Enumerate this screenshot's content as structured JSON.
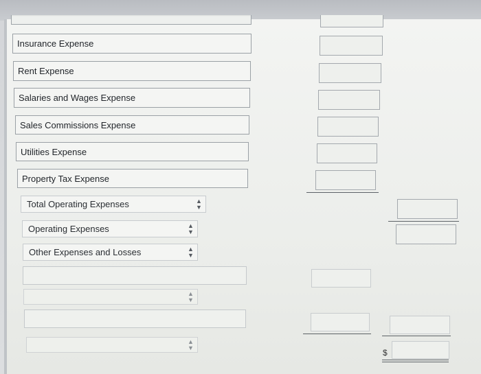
{
  "rows": {
    "insurance": "Insurance Expense",
    "rent": "Rent Expense",
    "salaries": "Salaries and Wages Expense",
    "sales_commissions": "Sales Commissions Expense",
    "utilities": "Utilities Expense",
    "property_tax": "Property Tax Expense"
  },
  "selects": {
    "total_operating": "Total Operating Expenses",
    "operating": "Operating Expenses",
    "other_expenses": "Other Expenses and Losses"
  },
  "icons": {
    "select_arrow": "up-down-arrows-icon"
  },
  "currency_symbol": "$"
}
